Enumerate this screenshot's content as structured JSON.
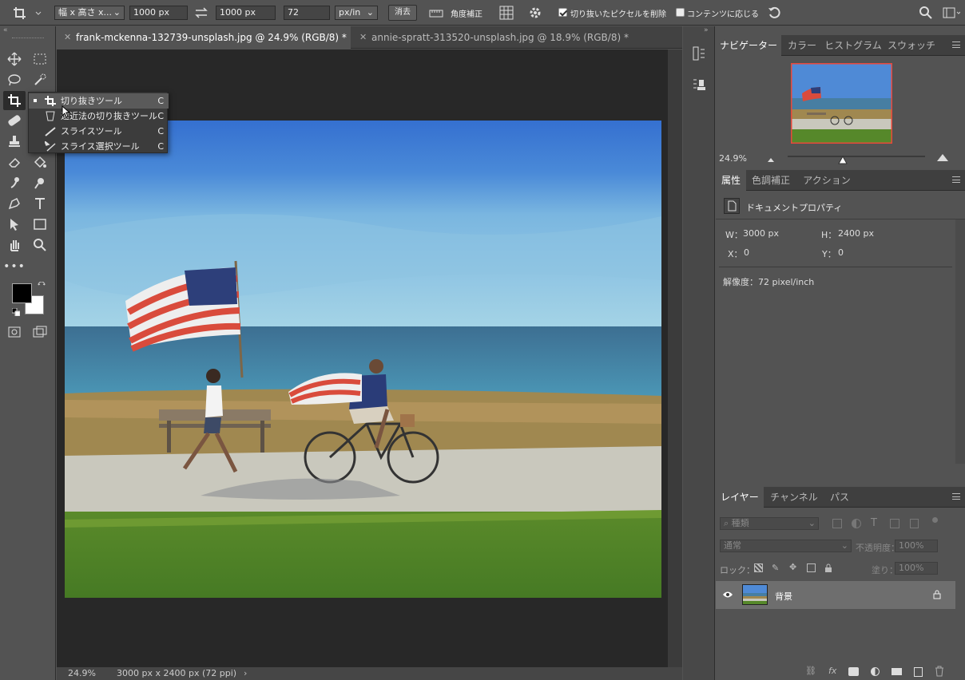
{
  "options_bar": {
    "ratio_select": "幅 x 高さ x...",
    "width_value": "1000 px",
    "height_value": "1000 px",
    "resolution_value": "72",
    "resolution_unit": "px/in",
    "clear_label": "消去",
    "straighten_label": "角度補正",
    "delete_pixels_label": "切り抜いたピクセルを削除",
    "content_aware_label": "コンテンツに応じる"
  },
  "tabs": [
    {
      "label": "frank-mckenna-132739-unsplash.jpg @ 24.9% (RGB/8) *"
    },
    {
      "label": "annie-spratt-313520-unsplash.jpg @ 18.9% (RGB/8) *"
    }
  ],
  "tool_menu": {
    "items": [
      {
        "label": "切り抜きツール",
        "key": "C"
      },
      {
        "label": "遠近法の切り抜きツール",
        "key": "C"
      },
      {
        "label": "スライスツール",
        "key": "C"
      },
      {
        "label": "スライス選択ツール",
        "key": "C"
      }
    ]
  },
  "status_bar": {
    "zoom": "24.9%",
    "doc_info": "3000 px x 2400 px (72 ppi)"
  },
  "navigator_panel": {
    "tabs": [
      "ナビゲーター",
      "カラー",
      "ヒストグラム",
      "スウォッチ"
    ],
    "zoom": "24.9%",
    "zoom_slider_fraction": 0.4
  },
  "properties_panel": {
    "tabs": [
      "属性",
      "色調補正",
      "アクション"
    ],
    "title": "ドキュメントプロパティ",
    "w_label": "W：",
    "w_value": "3000 px",
    "h_label": "H：",
    "h_value": "2400 px",
    "x_label": "X：",
    "x_value": "0",
    "y_label": "Y：",
    "y_value": "0",
    "resolution": "解像度：72 pixel/inch"
  },
  "layers_panel": {
    "tabs": [
      "レイヤー",
      "チャンネル",
      "パス"
    ],
    "filter_label": "種類",
    "blend_mode": "通常",
    "opacity_label": "不透明度：",
    "opacity_value": "100%",
    "lock_label": "ロック：",
    "fill_label": "塗り：",
    "fill_value": "100%",
    "layers": [
      {
        "name": "背景"
      }
    ]
  },
  "colors": {
    "accent": "#e8483b",
    "foreground": "#000000",
    "background": "#ffffff"
  }
}
